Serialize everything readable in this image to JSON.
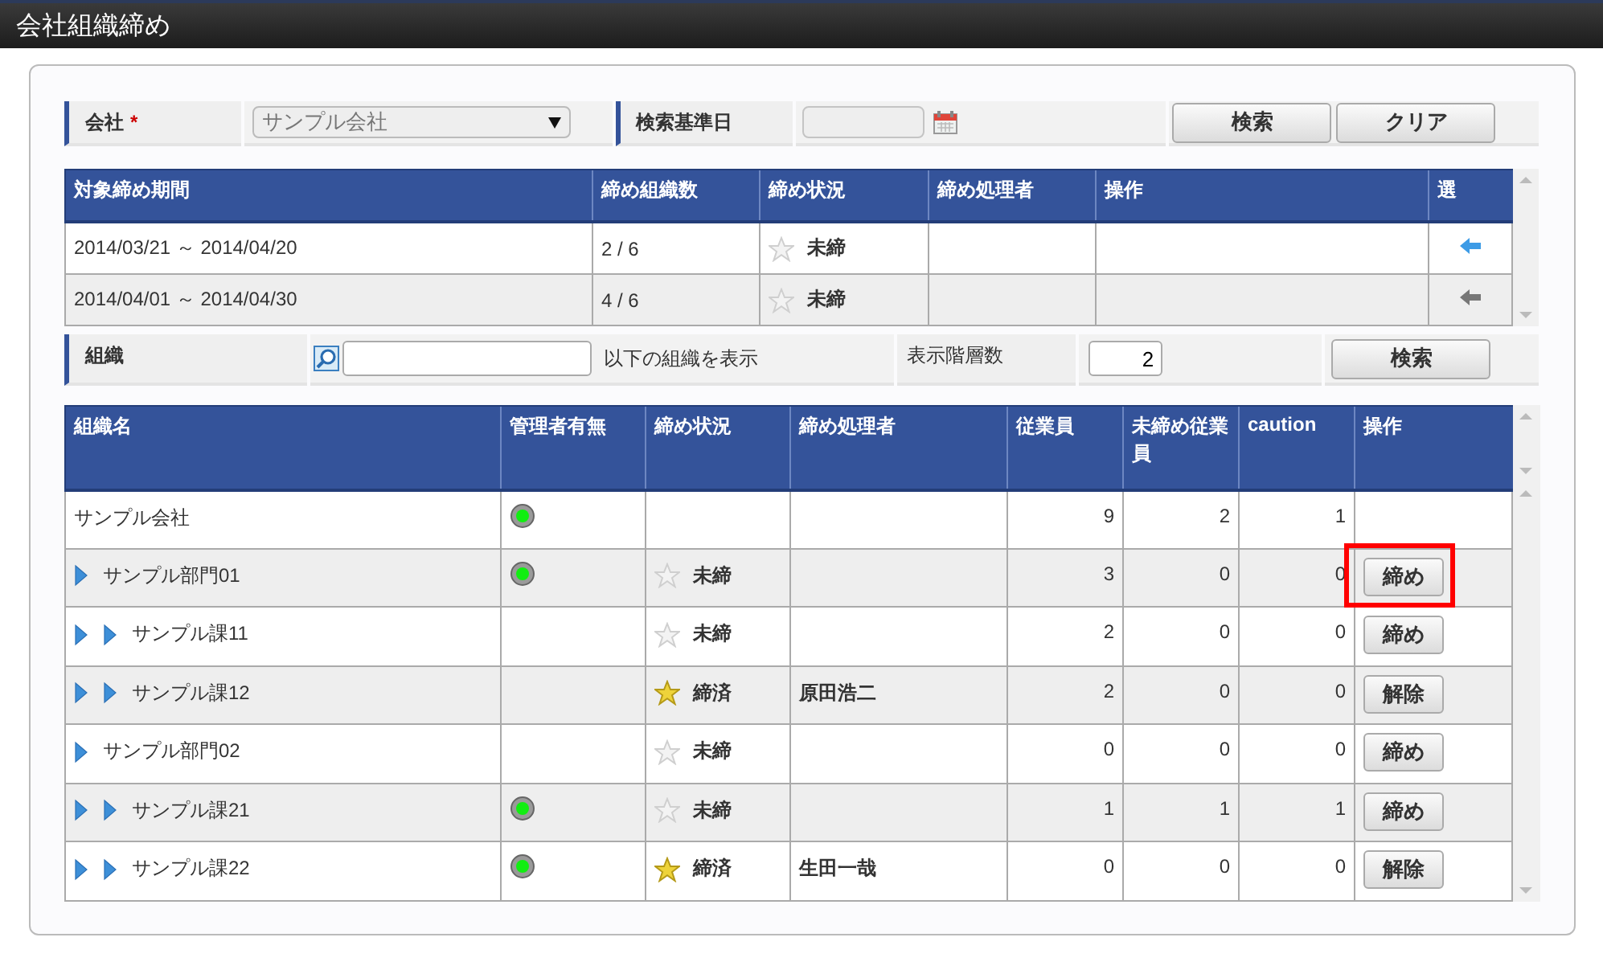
{
  "window": {
    "title": "会社組織締め"
  },
  "search_form": {
    "company": {
      "label": "会社",
      "required_mark": "*",
      "value": "サンプル会社"
    },
    "base_date": {
      "label": "検索基準日"
    },
    "buttons": [
      "検索",
      "クリア"
    ]
  },
  "period_table": {
    "columns": [
      "対象締め期間",
      "締め組織数",
      "締め状況",
      "締め処理者",
      "操作",
      "選"
    ],
    "rows": [
      {
        "period": "2014/03/21 ～ 2014/04/20",
        "count": "2 / 6",
        "closed": false,
        "status": "未締",
        "selected": true
      },
      {
        "period": "2014/04/01 ～ 2014/04/30",
        "count": "4 / 6",
        "closed": false,
        "status": "未締",
        "selected": false
      }
    ]
  },
  "org_filter": {
    "label": "組織",
    "suffix": "以下の組織を表示",
    "depth_label": "表示階層数",
    "depth": "2",
    "button": "検索"
  },
  "org_table": {
    "columns": [
      "組織名",
      "管理者有無",
      "締め状況",
      "締め処理者",
      "従業員",
      "未締め従業員",
      "caution",
      "操作"
    ],
    "rows": [
      {
        "name": "サンプル会社",
        "has_manager": true,
        "employees": "9",
        "unclosed": "2",
        "caution": "1",
        "highlighted": false,
        "children": [
          {
            "name": "サンプル部門01",
            "has_manager": true,
            "closed": false,
            "status": "未締",
            "employees": "3",
            "unclosed": "0",
            "caution": "0",
            "action": "締め",
            "highlighted": true,
            "children": [
              {
                "name": "サンプル課11",
                "has_manager": false,
                "closed": false,
                "status": "未締",
                "employees": "2",
                "unclosed": "0",
                "caution": "0",
                "action": "締め",
                "highlighted": false
              },
              {
                "name": "サンプル課12",
                "has_manager": false,
                "closed": true,
                "status": "締済",
                "processor": "原田浩二",
                "employees": "2",
                "unclosed": "0",
                "caution": "0",
                "action": "解除",
                "highlighted": false
              }
            ]
          },
          {
            "name": "サンプル部門02",
            "has_manager": false,
            "closed": false,
            "status": "未締",
            "employees": "0",
            "unclosed": "0",
            "caution": "0",
            "action": "締め",
            "highlighted": false,
            "children": [
              {
                "name": "サンプル課21",
                "has_manager": true,
                "closed": false,
                "status": "未締",
                "employees": "1",
                "unclosed": "1",
                "caution": "1",
                "action": "締め",
                "highlighted": false
              },
              {
                "name": "サンプル課22",
                "has_manager": true,
                "closed": true,
                "status": "締済",
                "processor": "生田一哉",
                "employees": "0",
                "unclosed": "0",
                "caution": "0",
                "action": "解除",
                "highlighted": false
              }
            ]
          }
        ]
      }
    ]
  }
}
